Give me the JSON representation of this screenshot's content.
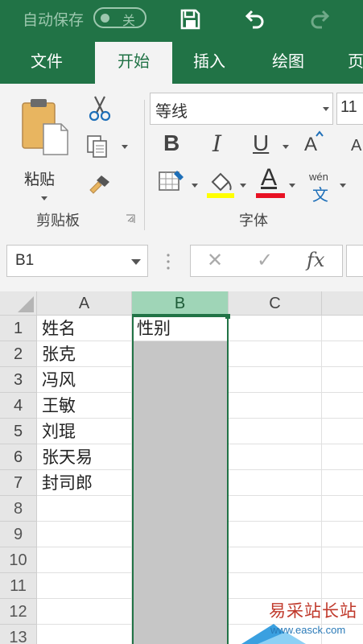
{
  "titlebar": {
    "autosave_label": "自动保存",
    "autosave_state": "关",
    "icons": [
      "save-icon",
      "undo-icon",
      "redo-icon"
    ]
  },
  "tabs": [
    {
      "label": "文件",
      "active": false
    },
    {
      "label": "开始",
      "active": true
    },
    {
      "label": "插入",
      "active": false
    },
    {
      "label": "绘图",
      "active": false
    },
    {
      "label": "页",
      "active": false
    }
  ],
  "ribbon": {
    "clipboard": {
      "paste_label": "粘贴",
      "group_label": "剪贴板",
      "icons": [
        "paste-icon",
        "cut-icon",
        "copy-icon",
        "format-painter-icon",
        "dialog-launcher-icon"
      ]
    },
    "font": {
      "group_label": "字体",
      "font_name": "等线",
      "font_size": "11",
      "bold": "B",
      "italic": "I",
      "underline": "U",
      "grow": "A",
      "shrink": "A",
      "font_color_letter": "A",
      "phonetic_top": "wén",
      "phonetic_bottom": "文",
      "highlight_color": "#ffff00",
      "font_color": "#e81123"
    }
  },
  "formula_bar": {
    "name_box": "B1",
    "cancel": "✕",
    "enter": "✓",
    "fx": "fx"
  },
  "sheet": {
    "columns": [
      "A",
      "B",
      "C"
    ],
    "selected_column": "B",
    "rows": [
      {
        "num": "1",
        "a": "姓名",
        "b": "性别"
      },
      {
        "num": "2",
        "a": "张克",
        "b": ""
      },
      {
        "num": "3",
        "a": "冯风",
        "b": ""
      },
      {
        "num": "4",
        "a": "王敏",
        "b": ""
      },
      {
        "num": "5",
        "a": "刘琨",
        "b": ""
      },
      {
        "num": "6",
        "a": "张天易",
        "b": ""
      },
      {
        "num": "7",
        "a": "封司郎",
        "b": ""
      },
      {
        "num": "8",
        "a": "",
        "b": ""
      },
      {
        "num": "9",
        "a": "",
        "b": ""
      },
      {
        "num": "10",
        "a": "",
        "b": ""
      },
      {
        "num": "11",
        "a": "",
        "b": ""
      },
      {
        "num": "12",
        "a": "",
        "b": ""
      },
      {
        "num": "13",
        "a": "",
        "b": ""
      }
    ]
  },
  "watermark": {
    "title": "易采站长站",
    "url": "www.easck.com"
  }
}
